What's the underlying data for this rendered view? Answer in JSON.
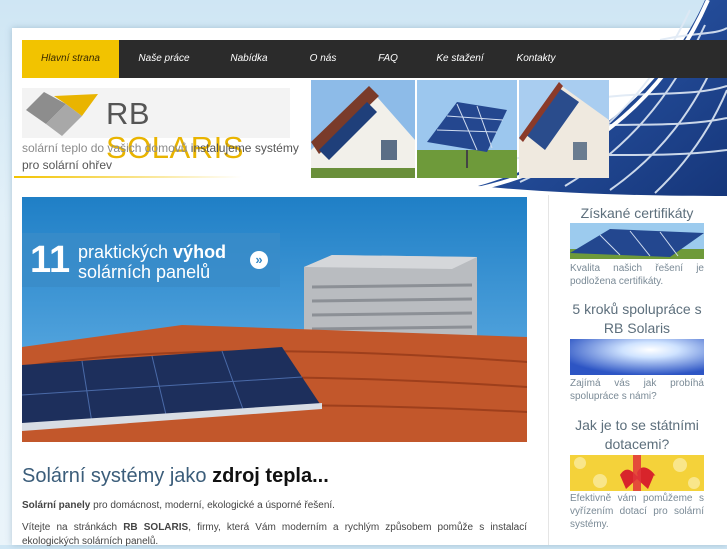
{
  "nav": {
    "items": [
      {
        "label": "Hlavní strana",
        "active": true
      },
      {
        "label": "Naše práce",
        "active": false
      },
      {
        "label": "Nabídka",
        "active": false
      },
      {
        "label": "O nás",
        "active": false
      },
      {
        "label": "FAQ",
        "active": false
      },
      {
        "label": "Ke stažení",
        "active": false
      },
      {
        "label": "Kontakty",
        "active": false
      }
    ]
  },
  "logo": {
    "text_main": "RB",
    "text_accent": "SOLARIS"
  },
  "tagline": {
    "light": "solární teplo do vašich domovů",
    "strong": "instalujeme systémy pro solární ohřev"
  },
  "hero": {
    "number": "11",
    "line1_plain": "praktických",
    "line1_bold": "výhod",
    "line2": "solárních panelů",
    "arrow": "»"
  },
  "main": {
    "heading_plain": "Solární systémy jako",
    "heading_bold": "zdroj tepla...",
    "p1_bold": "Solární panely",
    "p1_rest": "pro domácnost, moderní, ekologické a úsporné řešení.",
    "p2_start": "Vítejte na stránkách",
    "p2_bold": "RB SOLARIS",
    "p2_rest": ", firmy, která Vám moderním a rychlým způsobem pomůže s instalací ekologických solárních panelů."
  },
  "sidebar": {
    "blocks": [
      {
        "title": "Získané certifikáty",
        "text": "Kvalita našich řešení je podložena certifikáty."
      },
      {
        "title": "5 kroků spolupráce s RB Solaris",
        "text": "Zajímá vás jak probíhá spolupráce s námi?"
      },
      {
        "title": "Jak je to se státními dotacemi?",
        "text": "Efektivně vám pomůžeme s vyřízením dotací pro solární systémy."
      }
    ]
  },
  "colors": {
    "accent": "#f2c300",
    "nav_bg": "#2b2b2b",
    "hero_badge": "#3a8cc8"
  }
}
